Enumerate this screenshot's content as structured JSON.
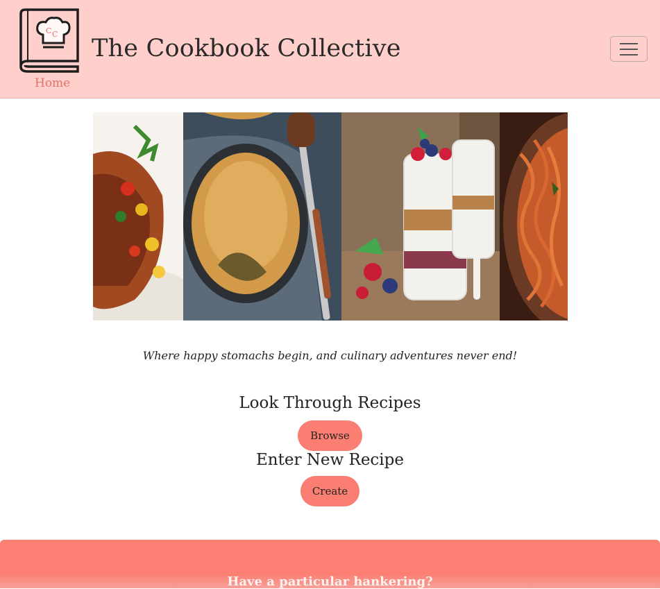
{
  "navbar": {
    "home_label": "Home",
    "title": "The Cookbook Collective",
    "logo_initials": "CC"
  },
  "carousel": {
    "slides": [
      "salmon-dish-image",
      "pot-pie-image",
      "yogurt-parfait-image",
      "spaghetti-image"
    ]
  },
  "main": {
    "tagline": "Where happy stomachs begin, and culinary adventures never end!",
    "browse_heading": "Look Through Recipes",
    "browse_button": "Browse",
    "create_heading": "Enter New Recipe",
    "create_button": "Create"
  },
  "footer": {
    "text": "Have a particular hankering?"
  },
  "colors": {
    "navbar_bg": "#ffcfcb",
    "accent": "#fa7f72",
    "home_link": "#e2736a"
  }
}
